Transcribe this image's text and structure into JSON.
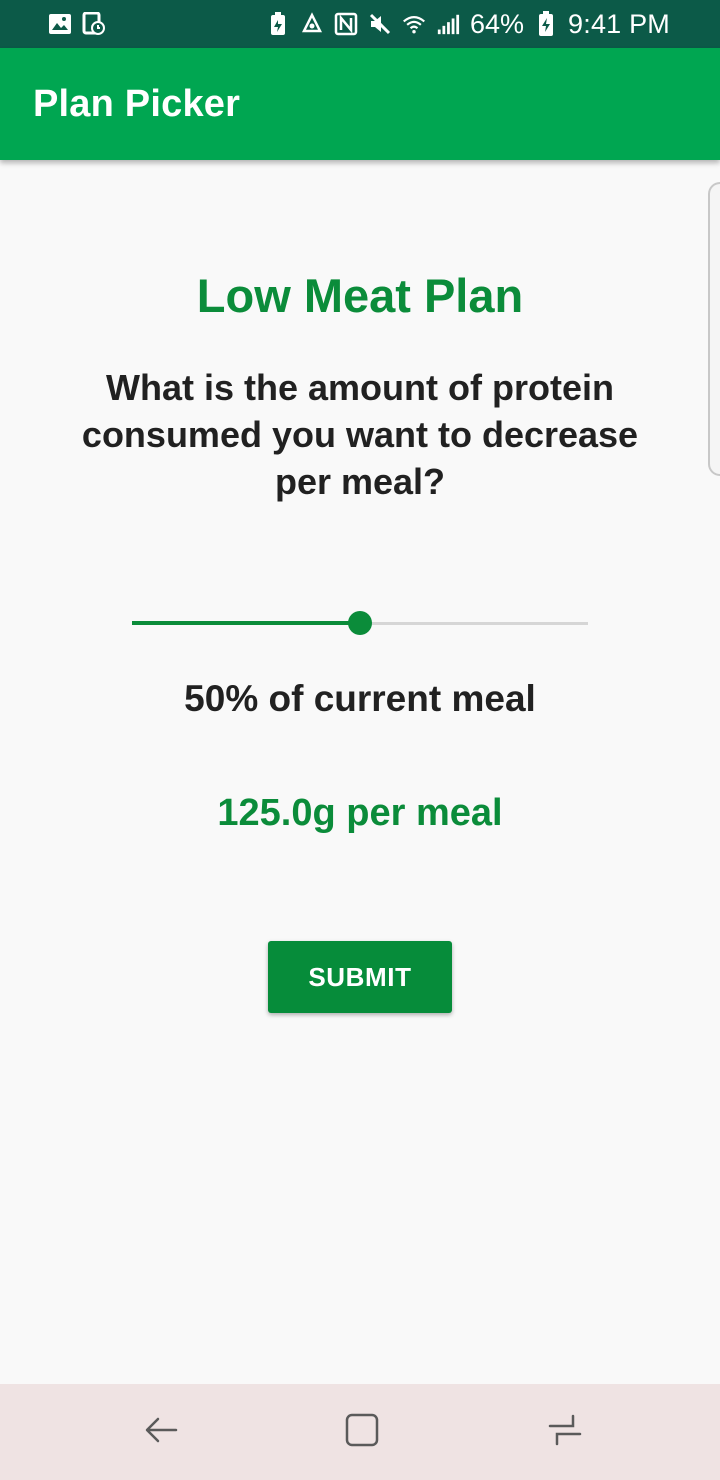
{
  "status_bar": {
    "left_icons": [
      "gallery-icon",
      "screen-record-icon"
    ],
    "right_icons": [
      "battery-saver-icon",
      "recycle-icon",
      "nfc-icon",
      "mute-icon",
      "wifi-icon",
      "signal-icon"
    ],
    "battery_percent": "64%",
    "battery_icon": "battery-charging-icon",
    "time": "9:41 PM"
  },
  "app_bar": {
    "title": "Plan Picker"
  },
  "main": {
    "plan_title": "Low Meat Plan",
    "question": "What is the amount of protein consumed you want to decrease per meal?",
    "slider": {
      "value_fraction": 0.5
    },
    "percent_label": "50% of current meal",
    "grams_label": "125.0g per meal",
    "submit_label": "SUBMIT"
  },
  "nav_bar": {
    "icons": [
      "back-icon",
      "home-icon",
      "recent-apps-icon"
    ]
  },
  "colors": {
    "status_bar": "#0c5a48",
    "app_bar": "#00a651",
    "accent": "#0b8c3a",
    "background": "#f9f9f9",
    "nav_bar": "#efe3e3"
  }
}
